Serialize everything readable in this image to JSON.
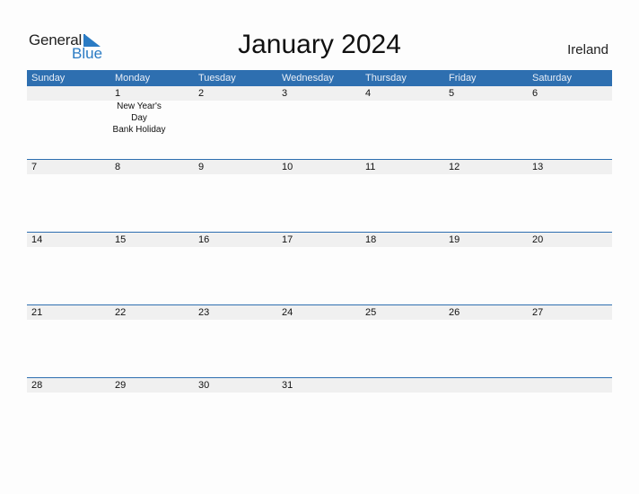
{
  "logo": {
    "line1": "General",
    "line2": "Blue"
  },
  "title": "January 2024",
  "country": "Ireland",
  "colors": {
    "accent": "#2e6fb0",
    "strip": "#f0f0f0",
    "logo_blue": "#2a7bc4"
  },
  "weekdays": [
    "Sunday",
    "Monday",
    "Tuesday",
    "Wednesday",
    "Thursday",
    "Friday",
    "Saturday"
  ],
  "weeks": [
    [
      {
        "day": ""
      },
      {
        "day": "1",
        "events": [
          "New Year's Day",
          "Bank Holiday"
        ]
      },
      {
        "day": "2"
      },
      {
        "day": "3"
      },
      {
        "day": "4"
      },
      {
        "day": "5"
      },
      {
        "day": "6"
      }
    ],
    [
      {
        "day": "7"
      },
      {
        "day": "8"
      },
      {
        "day": "9"
      },
      {
        "day": "10"
      },
      {
        "day": "11"
      },
      {
        "day": "12"
      },
      {
        "day": "13"
      }
    ],
    [
      {
        "day": "14"
      },
      {
        "day": "15"
      },
      {
        "day": "16"
      },
      {
        "day": "17"
      },
      {
        "day": "18"
      },
      {
        "day": "19"
      },
      {
        "day": "20"
      }
    ],
    [
      {
        "day": "21"
      },
      {
        "day": "22"
      },
      {
        "day": "23"
      },
      {
        "day": "24"
      },
      {
        "day": "25"
      },
      {
        "day": "26"
      },
      {
        "day": "27"
      }
    ],
    [
      {
        "day": "28"
      },
      {
        "day": "29"
      },
      {
        "day": "30"
      },
      {
        "day": "31"
      },
      {
        "day": ""
      },
      {
        "day": ""
      },
      {
        "day": ""
      }
    ]
  ]
}
